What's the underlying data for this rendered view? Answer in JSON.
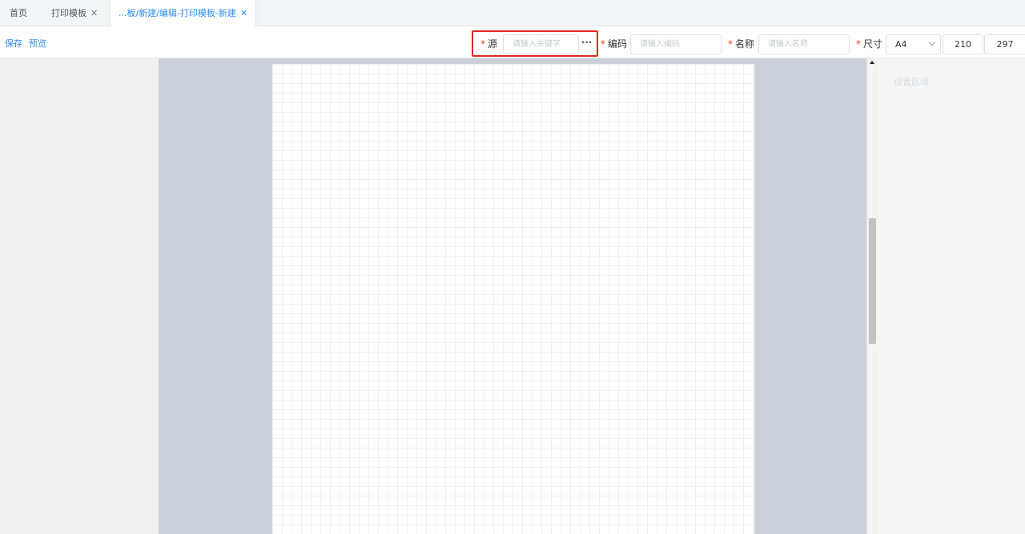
{
  "tabs": [
    {
      "label": "首页",
      "closable": false,
      "active": false
    },
    {
      "label": "打印模板",
      "closable": true,
      "active": false
    },
    {
      "label": "...板/新建/编辑-打印模板-新建",
      "closable": true,
      "active": true
    }
  ],
  "toolbar": {
    "save_label": "保存",
    "preview_label": "预览"
  },
  "form": {
    "required_mark": "*",
    "source": {
      "label": "源",
      "placeholder": "请输入关键字",
      "more_glyph": "···"
    },
    "code": {
      "label": "编码",
      "placeholder": "请输入编码"
    },
    "name": {
      "label": "名称",
      "placeholder": "请输入名称"
    },
    "size": {
      "label": "尺寸",
      "selected": "A4",
      "width": "210",
      "height": "297"
    }
  },
  "settings_panel": {
    "title": "设置区域"
  },
  "colors": {
    "accent": "#2d8cf0",
    "required": "#ed4014",
    "highlight": "#e3261e"
  },
  "icons": {
    "close": "close-icon",
    "more": "more-dots-icon",
    "select": "chevron-down-icon"
  }
}
